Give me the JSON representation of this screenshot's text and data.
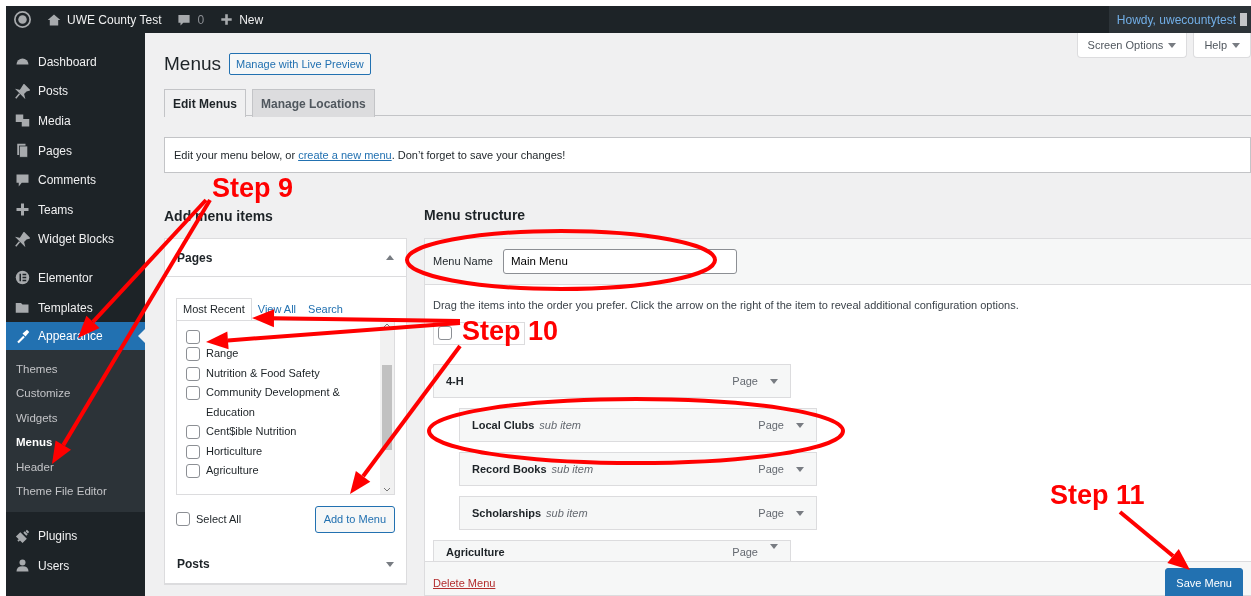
{
  "admin_bar": {
    "site_name": "UWE County Test",
    "comments_count": "0",
    "new_label": "New",
    "greeting": "Howdy, uwecountytest"
  },
  "sidebar": {
    "items": [
      {
        "label": "Dashboard",
        "selected": false
      },
      {
        "label": "Posts",
        "selected": false
      },
      {
        "label": "Media",
        "selected": false
      },
      {
        "label": "Pages",
        "selected": false
      },
      {
        "label": "Comments",
        "selected": false
      },
      {
        "label": "Teams",
        "selected": false
      },
      {
        "label": "Widget Blocks",
        "selected": false
      },
      {
        "label": "Elementor",
        "selected": false
      },
      {
        "label": "Templates",
        "selected": false
      },
      {
        "label": "Appearance",
        "selected": true,
        "children": [
          {
            "label": "Themes",
            "selected": false
          },
          {
            "label": "Customize",
            "selected": false
          },
          {
            "label": "Widgets",
            "selected": false
          },
          {
            "label": "Menus",
            "selected": true
          },
          {
            "label": "Header",
            "selected": false
          },
          {
            "label": "Theme File Editor",
            "selected": false
          }
        ]
      },
      {
        "label": "Plugins",
        "selected": false
      },
      {
        "label": "Users",
        "selected": false
      }
    ]
  },
  "screen_meta": [
    "Screen Options",
    "Help"
  ],
  "page_title": "Menus",
  "title_action": "Manage with Live Preview",
  "tabs": [
    {
      "label": "Edit Menus",
      "selected": true
    },
    {
      "label": "Manage Locations",
      "selected": false
    }
  ],
  "notice": {
    "before": "Edit your menu below, or ",
    "link": "create a new menu",
    "after": ". Don’t forget to save your changes!"
  },
  "add_items": {
    "heading": "Add menu items",
    "sections": [
      {
        "title": "Pages",
        "expanded": true
      },
      {
        "title": "Posts",
        "expanded": false
      }
    ],
    "tabs": [
      {
        "label": "Most Recent",
        "selected": true
      },
      {
        "label": "View All",
        "selected": false
      },
      {
        "label": "Search",
        "selected": false
      }
    ],
    "pages": [
      {
        "checked": false
      },
      {
        "label": "Range",
        "checked": false
      },
      {
        "label": "Nutrition & Food Safety",
        "checked": false
      },
      {
        "label": "Community Development & Education",
        "checked": false
      },
      {
        "label": "Cent$ible Nutrition",
        "checked": false
      },
      {
        "label": "Horticulture",
        "checked": false
      },
      {
        "label": "Agriculture",
        "checked": false
      }
    ],
    "select_all": {
      "label": "Select All",
      "checked": false
    },
    "add_button": "Add to Menu"
  },
  "menu_structure": {
    "heading": "Menu structure",
    "name_label": "Menu Name",
    "name_value": "Main Menu",
    "instructions": "Drag the items into the order you prefer. Click the arrow on the right of the item to reveal additional configuration options.",
    "bulk_select": {
      "checked": false
    },
    "items": [
      {
        "title": "4-H",
        "type": "Page",
        "children": [
          {
            "title": "Local Clubs",
            "note": "sub item",
            "type": "Page"
          },
          {
            "title": "Record Books",
            "note": "sub item",
            "type": "Page"
          },
          {
            "title": "Scholarships",
            "note": "sub item",
            "type": "Page"
          }
        ]
      },
      {
        "title": "Agriculture",
        "type": "Page"
      }
    ],
    "delete_link": "Delete Menu",
    "save_button": "Save Menu"
  },
  "annotations": [
    {
      "text": "Step 9"
    },
    {
      "text": "Step 10"
    },
    {
      "text": "Step 11"
    }
  ]
}
